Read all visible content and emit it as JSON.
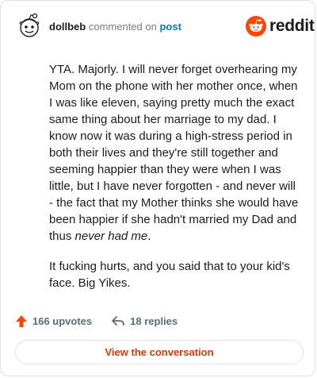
{
  "header": {
    "username": "dollbeb",
    "verb": "commented on",
    "post_link": "post"
  },
  "brand": {
    "wordmark": "reddit",
    "logo_icon": "reddit-alien-icon",
    "accent": "#ff4500"
  },
  "comment": {
    "paragraph1_main": "YTA. Majorly. I will never forget overhearing my Mom on the phone with her mother once, when I was like eleven, saying pretty much the exact same thing about her marriage to my dad. I know now it was during a high-stress period in both their lives and they're still together and seeming happier than they were when I was little, but I have never forgotten - and never will - the fact that my Mother thinks she would have been happier if she hadn't married my Dad and thus ",
    "paragraph1_italic": "never had me",
    "paragraph1_end": ".",
    "paragraph2": "It fucking hurts, and you said that to your kid's face. Big Yikes."
  },
  "footer": {
    "upvotes": "166 upvotes",
    "upvote_icon": "upvote-arrow-icon",
    "upvote_color": "#ff4500",
    "replies": "18 replies",
    "reply_icon": "reply-arrow-icon"
  },
  "cta": {
    "label": "View the conversation",
    "color": "#d93a00"
  }
}
